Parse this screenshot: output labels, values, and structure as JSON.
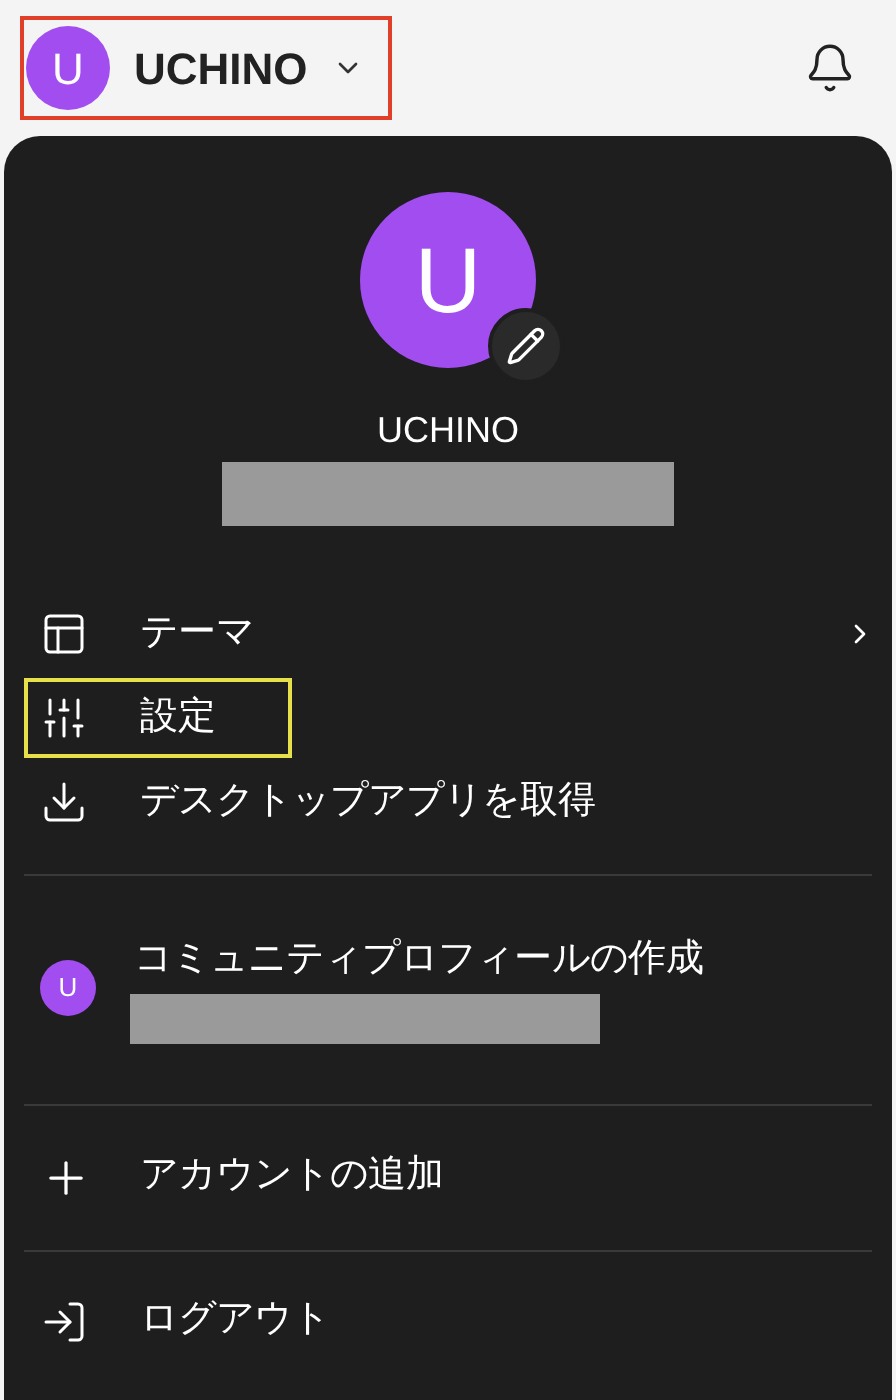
{
  "header": {
    "account_button": {
      "avatar_letter": "U",
      "name": "UCHINO",
      "outlined": true
    }
  },
  "menu": {
    "profile": {
      "avatar_letter": "U",
      "name": "UCHINO",
      "detail_redacted": true
    },
    "items": [
      {
        "kind": "theme",
        "label": "テーマ",
        "has_submenu": true,
        "highlighted": false
      },
      {
        "kind": "settings",
        "label": "設定",
        "has_submenu": false,
        "highlighted": true
      },
      {
        "kind": "download",
        "label": "デスクトップアプリを取得",
        "has_submenu": false,
        "highlighted": false
      }
    ],
    "community": {
      "avatar_letter": "U",
      "label": "コミュニティプロフィールの作成",
      "detail_redacted": true
    },
    "add_account": {
      "label": "アカウントの追加"
    },
    "logout": {
      "label": "ログアウト"
    }
  }
}
